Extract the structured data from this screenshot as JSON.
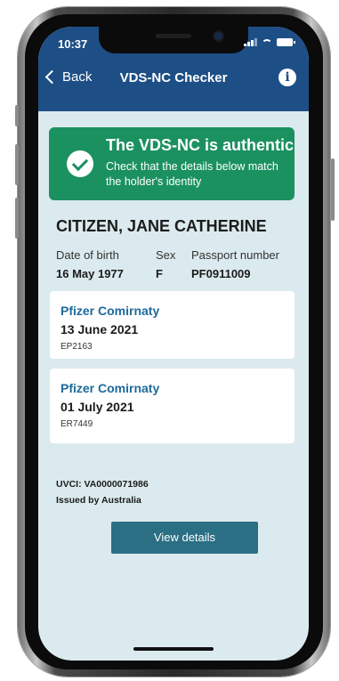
{
  "status_bar": {
    "time": "10:37"
  },
  "nav": {
    "back_label": "Back",
    "title": "VDS-NC Checker",
    "info_glyph": "i"
  },
  "banner": {
    "title": "The VDS-NC is authentic",
    "subtitle": "Check that the details below match the holder's identity"
  },
  "holder": {
    "name": "CITIZEN, JANE CATHERINE",
    "dob_label": "Date of birth",
    "dob_value": "16 May 1977",
    "sex_label": "Sex",
    "sex_value": "F",
    "passport_label": "Passport number",
    "passport_value": "PF0911009"
  },
  "vaccinations": [
    {
      "vaccine": "Pfizer Comirnaty",
      "date": "13 June 2021",
      "batch": "EP2163"
    },
    {
      "vaccine": "Pfizer Comirnaty",
      "date": "01 July 2021",
      "batch": "ER7449"
    }
  ],
  "certificate": {
    "uvci": "UVCI: VA0000071986",
    "issuer": "Issued by Australia"
  },
  "actions": {
    "view_details_label": "View details"
  },
  "colors": {
    "nav_blue": "#1d4f86",
    "success_green": "#1b9160",
    "vaccine_blue": "#1d6a9b",
    "button_teal": "#2b6f84",
    "screen_bg": "#dbeaee"
  },
  "icons": {
    "back": "chevron-left-icon",
    "info": "info-icon",
    "check": "check-circle-icon"
  }
}
